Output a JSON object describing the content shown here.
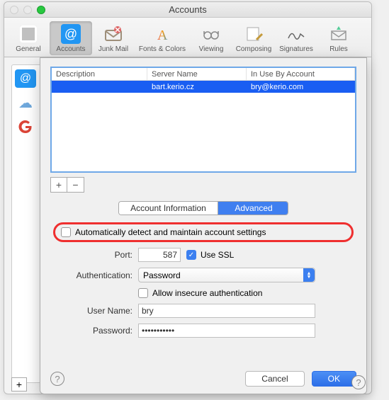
{
  "window": {
    "title": "Accounts"
  },
  "toolbar": {
    "items": [
      {
        "label": "General"
      },
      {
        "label": "Accounts"
      },
      {
        "label": "Junk Mail"
      },
      {
        "label": "Fonts & Colors"
      },
      {
        "label": "Viewing"
      },
      {
        "label": "Composing"
      },
      {
        "label": "Signatures"
      },
      {
        "label": "Rules"
      }
    ]
  },
  "table": {
    "headers": {
      "c1": "Description",
      "c2": "Server Name",
      "c3": "In Use By Account"
    },
    "rows": [
      {
        "description": "",
        "server": "bart.kerio.cz",
        "account": "bry@kerio.com"
      }
    ]
  },
  "tabs": {
    "info": "Account Information",
    "advanced": "Advanced"
  },
  "auto_detect": {
    "label": "Automatically detect and maintain account settings",
    "checked": false
  },
  "form": {
    "port": {
      "label": "Port:",
      "value": "587"
    },
    "ssl": {
      "label": "Use SSL",
      "checked": true
    },
    "auth": {
      "label": "Authentication:",
      "value": "Password"
    },
    "insecure": {
      "label": "Allow insecure authentication",
      "checked": false
    },
    "user": {
      "label": "User Name:",
      "value": "bry"
    },
    "password": {
      "label": "Password:",
      "value": "•••••••••••"
    }
  },
  "buttons": {
    "cancel": "Cancel",
    "ok": "OK"
  },
  "glyphs": {
    "plus": "+",
    "minus": "−",
    "at": "@",
    "help": "?",
    "check": "✓"
  }
}
